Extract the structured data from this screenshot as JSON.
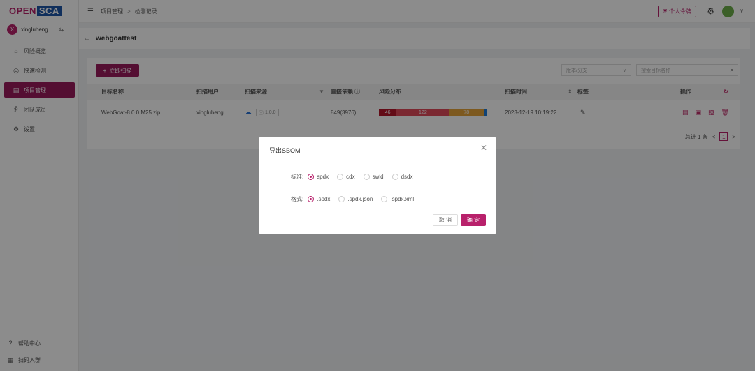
{
  "logo": {
    "open": "OPEN",
    "sca": "SCA"
  },
  "user": {
    "initial": "X",
    "name": "xingluheng...",
    "switch": "⇆"
  },
  "nav": [
    {
      "icon": "⌂",
      "label": "风险概览"
    },
    {
      "icon": "◎",
      "label": "快速检测"
    },
    {
      "icon": "▤",
      "label": "项目管理"
    },
    {
      "icon": "ꆜ",
      "label": "团队成员"
    },
    {
      "icon": "⚙",
      "label": "设置"
    }
  ],
  "bottom": [
    {
      "icon": "?",
      "label": "帮助中心"
    },
    {
      "icon": "▦",
      "label": "扫码入群"
    }
  ],
  "breadcrumb": {
    "item1": "项目管理",
    "sep": ">",
    "item2": "检测记录"
  },
  "topbar": {
    "token_label": "个人令牌"
  },
  "page": {
    "title": "webgoattest"
  },
  "toolbar": {
    "scan_label": "立即扫描",
    "filter_placeholder": "版本/分支",
    "search_placeholder": "搜索目标名称"
  },
  "table": {
    "headers": {
      "target": "目标名称",
      "user": "扫描用户",
      "source": "扫描来源",
      "deps": "直接依赖",
      "risk": "风险分布",
      "time": "扫描时间",
      "tag": "标签",
      "ops": "操作"
    },
    "rows": [
      {
        "target": "WebGoat-8.0.0.M25.zip",
        "user": "xingluheng",
        "version": "1.0.0",
        "deps": "849(3976)",
        "risk": [
          {
            "value": "46",
            "color": "#b5162b"
          },
          {
            "value": "122",
            "color": "#e0495a"
          },
          {
            "value": "78",
            "color": "#e3a33a"
          },
          {
            "value": "",
            "color": "#1e7bd8"
          }
        ],
        "time": "2023-12-19 10:19:22"
      }
    ]
  },
  "pager": {
    "total": "总计 1 条",
    "page": "1"
  },
  "modal": {
    "title": "导出SBOM",
    "standard_label": "标准:",
    "standards": [
      "spdx",
      "cdx",
      "swid",
      "dsdx"
    ],
    "format_label": "格式:",
    "formats": [
      ".spdx",
      ".spdx.json",
      ".spdx.xml"
    ],
    "cancel": "取 消",
    "ok": "确 定"
  }
}
